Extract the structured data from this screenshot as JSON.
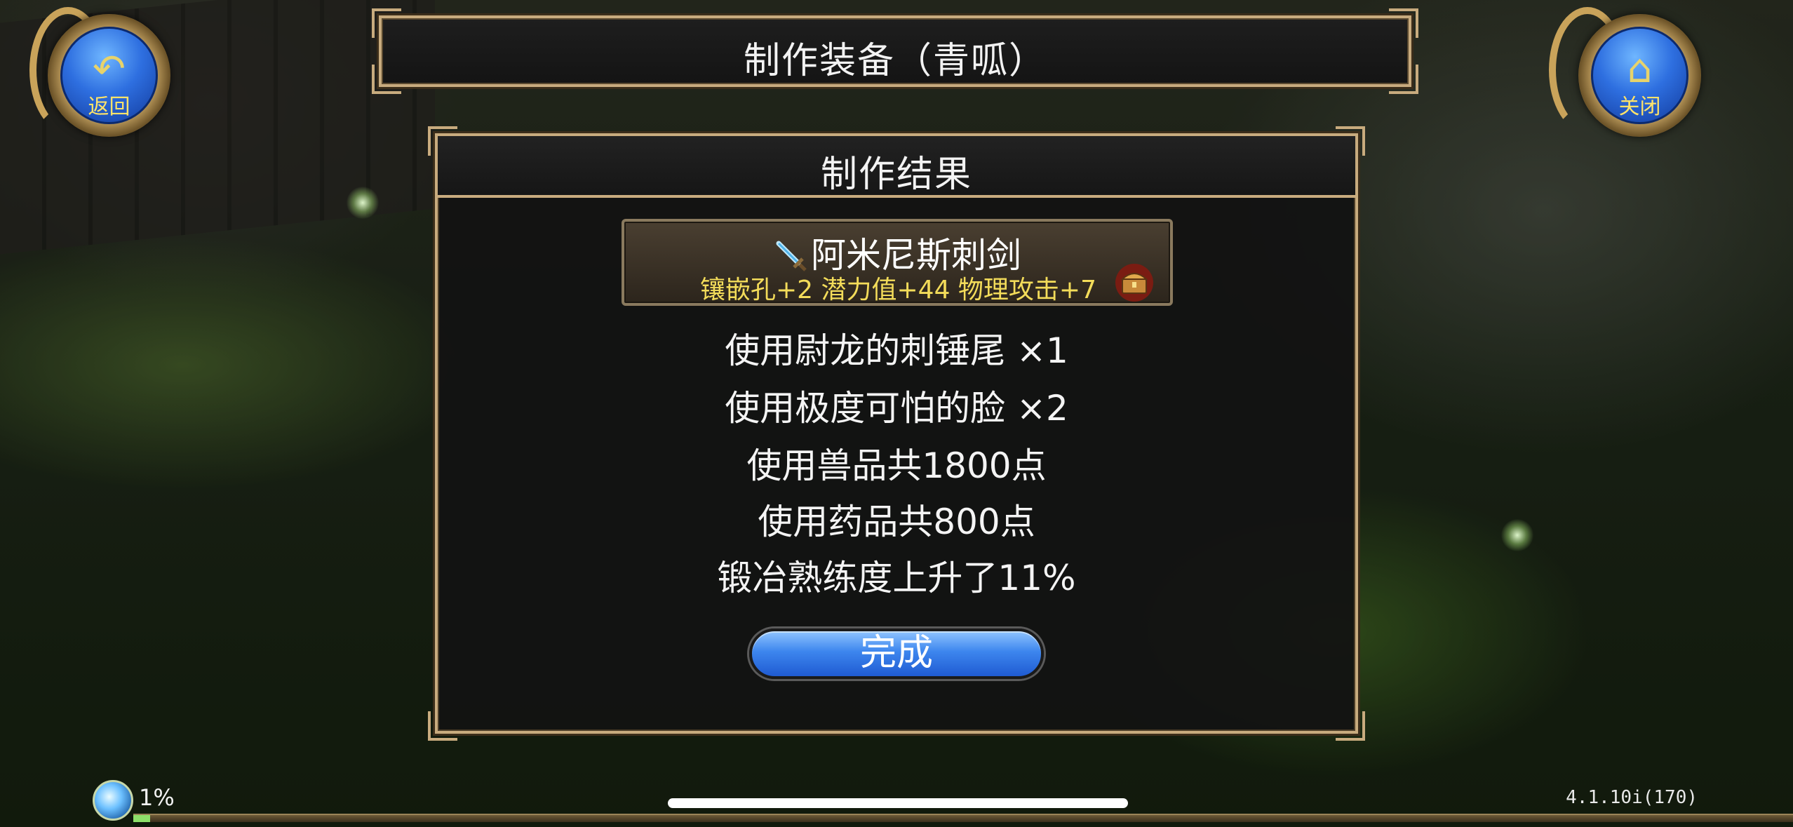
{
  "header": {
    "title": "制作装备（青呱）"
  },
  "back_button": {
    "label": "返回",
    "icon": "back-arrow-icon"
  },
  "close_button": {
    "label": "关闭",
    "icon": "home-icon"
  },
  "panel": {
    "title": "制作结果",
    "item": {
      "name": "阿米尼斯刺剑",
      "stats": "镶嵌孔+2 潜力值+44 物理攻击+7",
      "icon": "sword-icon",
      "badge_icon": "treasure-chest-icon"
    },
    "lines": [
      "使用尉龙的刺锤尾 ×1",
      "使用极度可怕的脸 ×2",
      "使用兽品共1800点",
      "使用药品共800点",
      "锻冶熟练度上升了11%"
    ],
    "done_label": "完成"
  },
  "hud": {
    "exp_percent_text": "1%",
    "exp_fraction": 0.01,
    "version": "4.1.10i(170)"
  },
  "colors": {
    "frame": "#c8ab7e",
    "stat_text": "#f3dc5a",
    "button_blue": "#3d86ee"
  }
}
